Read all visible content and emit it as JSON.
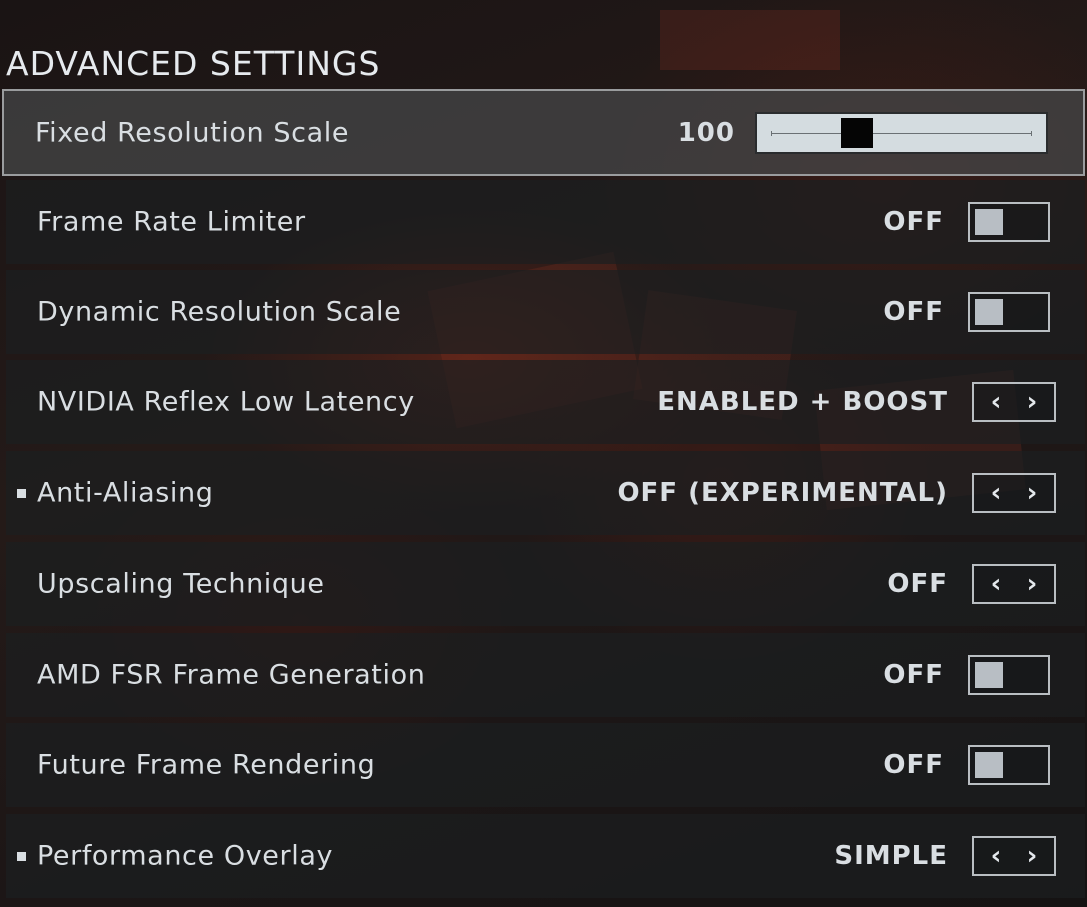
{
  "page": {
    "title": "ADVANCED SETTINGS"
  },
  "settings": [
    {
      "label": "Fixed Resolution Scale",
      "value": "100",
      "control": "slider",
      "slider_fraction": 0.33,
      "selected": true,
      "marker": false
    },
    {
      "label": "Frame Rate Limiter",
      "value": "OFF",
      "control": "toggle",
      "selected": false,
      "marker": false
    },
    {
      "label": "Dynamic Resolution Scale",
      "value": "OFF",
      "control": "toggle",
      "selected": false,
      "marker": false
    },
    {
      "label": "NVIDIA Reflex Low Latency",
      "value": "ENABLED + BOOST",
      "control": "arrows",
      "selected": false,
      "marker": false
    },
    {
      "label": "Anti-Aliasing",
      "value": "OFF (EXPERIMENTAL)",
      "control": "arrows",
      "selected": false,
      "marker": true
    },
    {
      "label": "Upscaling Technique",
      "value": "OFF",
      "control": "arrows",
      "selected": false,
      "marker": false
    },
    {
      "label": "AMD FSR Frame Generation",
      "value": "OFF",
      "control": "toggle",
      "selected": false,
      "marker": false
    },
    {
      "label": "Future Frame Rendering",
      "value": "OFF",
      "control": "toggle",
      "selected": false,
      "marker": false
    },
    {
      "label": "Performance Overlay",
      "value": "SIMPLE",
      "control": "arrows",
      "selected": false,
      "marker": true
    }
  ],
  "icons": {
    "left": "chevron-left-icon",
    "right": "chevron-right-icon"
  },
  "colors": {
    "row_bg": "#1c1e20",
    "selected_border": "#9a9c9e",
    "text": "#d9dee2",
    "slider_bg": "#d4dce0"
  }
}
